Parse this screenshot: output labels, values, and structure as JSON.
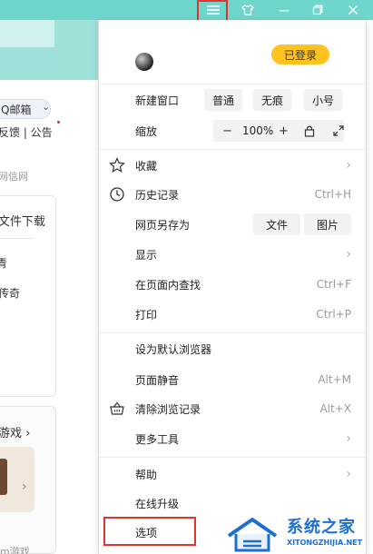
{
  "titlebar": {
    "buttons": [
      "menu-icon",
      "skin-icon",
      "minimize-icon",
      "restore-icon",
      "close-icon"
    ]
  },
  "page_behind": {
    "mail_label": "Q邮箱",
    "feedback_text": "反馈 | 公告",
    "xinwang_text": "网信网",
    "download_text": "文件下载",
    "item1": "青",
    "item2": "传奇",
    "games_text": "游戏",
    "bottom_text": "m游戏"
  },
  "menu": {
    "logged_in_badge": "已登录",
    "new_window": {
      "label": "新建窗口",
      "options": [
        "普通",
        "无痕",
        "小号"
      ]
    },
    "zoom": {
      "label": "缩放",
      "minus": "−",
      "value": "100%",
      "plus": "+"
    },
    "items": [
      {
        "label": "收藏",
        "icon": "star-icon",
        "shortcut": "",
        "submenu": true
      },
      {
        "label": "历史记录",
        "icon": "clock-icon",
        "shortcut": "Ctrl+H",
        "submenu": false
      },
      {
        "label": "网页另存为",
        "icon": "",
        "shortcut": "",
        "submenu": false,
        "buttons": [
          "文件",
          "图片"
        ]
      },
      {
        "label": "显示",
        "icon": "",
        "shortcut": "",
        "submenu": true
      },
      {
        "label": "在页面内查找",
        "icon": "",
        "shortcut": "Ctrl+F",
        "submenu": false
      },
      {
        "label": "打印",
        "icon": "",
        "shortcut": "Ctrl+P",
        "submenu": false
      },
      {
        "label": "设为默认浏览器",
        "icon": "",
        "shortcut": "",
        "submenu": false
      },
      {
        "label": "页面静音",
        "icon": "",
        "shortcut": "Alt+M",
        "submenu": false
      },
      {
        "label": "清除浏览记录",
        "icon": "basket-icon",
        "shortcut": "Alt+X",
        "submenu": false
      },
      {
        "label": "更多工具",
        "icon": "",
        "shortcut": "",
        "submenu": true
      },
      {
        "label": "帮助",
        "icon": "",
        "shortcut": "",
        "submenu": true
      },
      {
        "label": "在线升级",
        "icon": "",
        "shortcut": "",
        "submenu": false
      },
      {
        "label": "选项",
        "icon": "",
        "shortcut": "",
        "submenu": false
      }
    ]
  },
  "watermark": {
    "title": "系统之家",
    "url": "XITONGZHIJIA.NET"
  },
  "colors": {
    "titlebar": "#6fd6cb",
    "badge": "#ffc21e",
    "highlight": "#e0342f",
    "watermark": "#1c6fd1"
  }
}
